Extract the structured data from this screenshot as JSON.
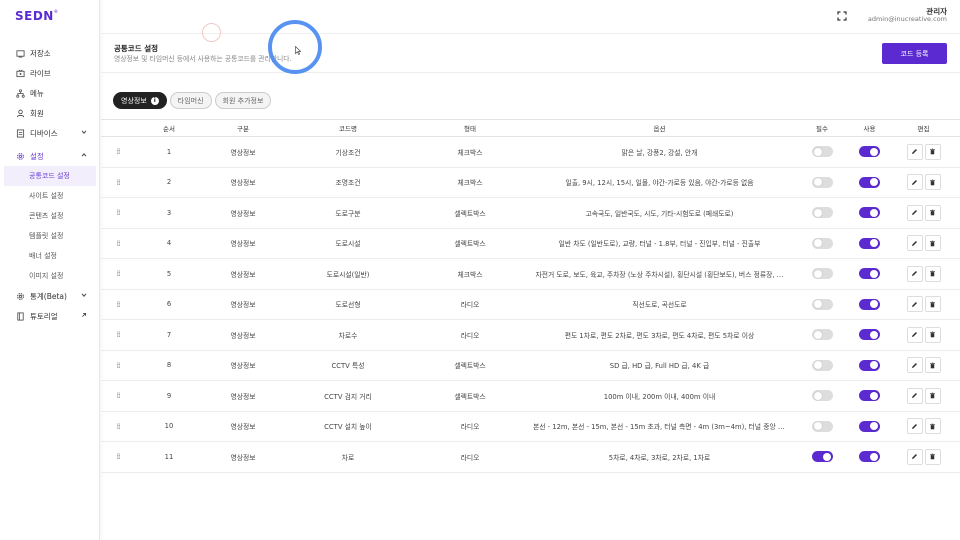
{
  "app": {
    "logo": "SEDN",
    "logo_mark": "®"
  },
  "sidebar": {
    "items": [
      {
        "label": "저장소",
        "icon": "archive-icon"
      },
      {
        "label": "라이브",
        "icon": "live-icon"
      },
      {
        "label": "메뉴",
        "icon": "menu-tree-icon"
      },
      {
        "label": "회원",
        "icon": "user-icon"
      },
      {
        "label": "디바이스",
        "icon": "device-icon"
      },
      {
        "label": "설정",
        "icon": "gear-icon"
      },
      {
        "label": "통계(Beta)",
        "icon": "stats-icon"
      },
      {
        "label": "튜토리얼",
        "icon": "book-icon"
      }
    ],
    "settings_sub": [
      "공통코드 설정",
      "사이트 설정",
      "콘텐츠 설정",
      "템플릿 설정",
      "배너 설정",
      "이미지 설정"
    ]
  },
  "header": {
    "user_name": "관리자",
    "user_email": "admin@inucreative.com"
  },
  "page": {
    "title": "공통코드 설정",
    "desc": "영상정보 및 타임머신 등에서 사용하는 공통코드를 관리합니다.",
    "add_button": "코드 등록"
  },
  "tabs": [
    {
      "label": "영상정보",
      "info": "i"
    },
    {
      "label": "타임머신"
    },
    {
      "label": "회원 추가정보"
    }
  ],
  "table": {
    "headers": [
      "순서",
      "구분",
      "코드명",
      "형태",
      "옵션",
      "필수",
      "사용",
      "편집"
    ],
    "rows": [
      {
        "order": "1",
        "category": "영상정보",
        "name": "기상조건",
        "type": "체크박스",
        "options": "맑은 날, 강풍2, 강설, 안개",
        "required": false,
        "used": true
      },
      {
        "order": "2",
        "category": "영상정보",
        "name": "조명조건",
        "type": "체크박스",
        "options": "일출, 9시, 12시, 15시, 일몰, 야간-가로등 있음, 야간-가로등 없음",
        "required": false,
        "used": true
      },
      {
        "order": "3",
        "category": "영상정보",
        "name": "도로구분",
        "type": "셀렉트박스",
        "options": "고속국도, 일반국도, 시도, 기타-시험도로 (페쇄도로)",
        "required": false,
        "used": true
      },
      {
        "order": "4",
        "category": "영상정보",
        "name": "도로시설",
        "type": "셀렉트박스",
        "options": "일반 차도 (일반도로), 교량, 터널 - 1.8부, 터널 - 진입부, 터널 - 진출부",
        "required": false,
        "used": true
      },
      {
        "order": "5",
        "category": "영상정보",
        "name": "도로시설(일반)",
        "type": "체크박스",
        "options": "자전거 도로, 보도, 육교, 주차장 (노상 주차시설), 횡단시설 (횡단보도), 버스 정류장, …",
        "required": false,
        "used": true
      },
      {
        "order": "6",
        "category": "영상정보",
        "name": "도로선형",
        "type": "라디오",
        "options": "직선도로, 곡선도로",
        "required": false,
        "used": true
      },
      {
        "order": "7",
        "category": "영상정보",
        "name": "차로수",
        "type": "라디오",
        "options": "편도 1차로, 편도 2차로, 편도 3차로, 편도 4차로, 편도 5차로 이상",
        "required": false,
        "used": true
      },
      {
        "order": "8",
        "category": "영상정보",
        "name": "CCTV 특성",
        "type": "셀렉트박스",
        "options": "SD 급, HD 급, Full HD 급, 4K 급",
        "required": false,
        "used": true
      },
      {
        "order": "9",
        "category": "영상정보",
        "name": "CCTV 검지 거리",
        "type": "셀렉트박스",
        "options": "100m 이내, 200m 이내, 400m 이내",
        "required": false,
        "used": true
      },
      {
        "order": "10",
        "category": "영상정보",
        "name": "CCTV 설치 높이",
        "type": "라디오",
        "options": "본선 - 12m, 본선 - 15m, 본선 - 15m 초과, 터널 측면 - 4m (3m~4m), 터널 중앙 - …",
        "required": false,
        "used": true
      },
      {
        "order": "11",
        "category": "영상정보",
        "name": "차로",
        "type": "라디오",
        "options": "5차로, 4차로, 3차로, 2차로, 1차로",
        "required": true,
        "used": true
      }
    ]
  }
}
